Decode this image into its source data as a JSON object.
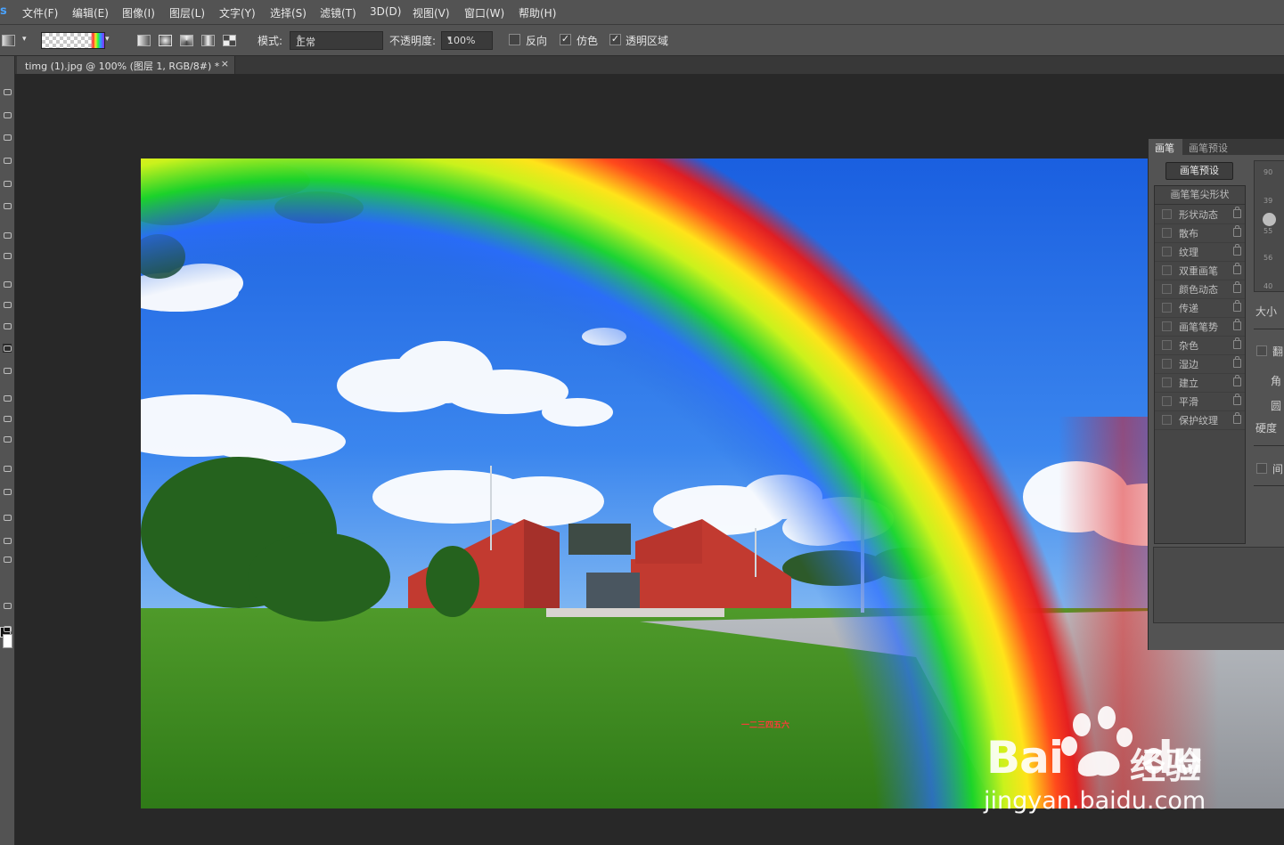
{
  "app": {
    "logo": "s"
  },
  "menu": [
    "文件(F)",
    "编辑(E)",
    "图像(I)",
    "图层(L)",
    "文字(Y)",
    "选择(S)",
    "滤镜(T)",
    "3D(D)",
    "视图(V)",
    "窗口(W)",
    "帮助(H)"
  ],
  "options": {
    "mode_label": "模式:",
    "mode_value": "正常",
    "opacity_label": "不透明度:",
    "opacity_value": "100%",
    "reverse_label": "反向",
    "reverse_checked": false,
    "dither_label": "仿色",
    "dither_checked": true,
    "transparency_label": "透明区域",
    "transparency_checked": true
  },
  "document": {
    "tab_title": "timg (1).jpg @ 100% (图层 1, RGB/8#) *",
    "close": "×"
  },
  "brush_panel": {
    "tabs": [
      "画笔",
      "画笔预设"
    ],
    "preset_button": "画笔预设",
    "tip_shape_header": "画笔笔尖形状",
    "options": [
      "形状动态",
      "散布",
      "纹理",
      "双重画笔",
      "颜色动态",
      "传递",
      "画笔笔势",
      "杂色",
      "湿边",
      "建立",
      "平滑",
      "保护纹理"
    ],
    "tip_sizes": [
      "90",
      "39",
      "55",
      "56",
      "40"
    ],
    "size_label": "大小",
    "flip_label": "翻",
    "angle_label": "角",
    "round_label": "圆",
    "hardness_label": "硬度",
    "spacing_label": "间"
  },
  "canvas": {
    "sign_text": "一二三四五六"
  },
  "watermark": {
    "brand": "Bai",
    "brand_end": "du",
    "cn": "经验",
    "url": "jingyan.baidu.com"
  },
  "colors": {
    "accent": "#4aa3ff",
    "foreground": "#111111",
    "background": "#ffffff"
  }
}
